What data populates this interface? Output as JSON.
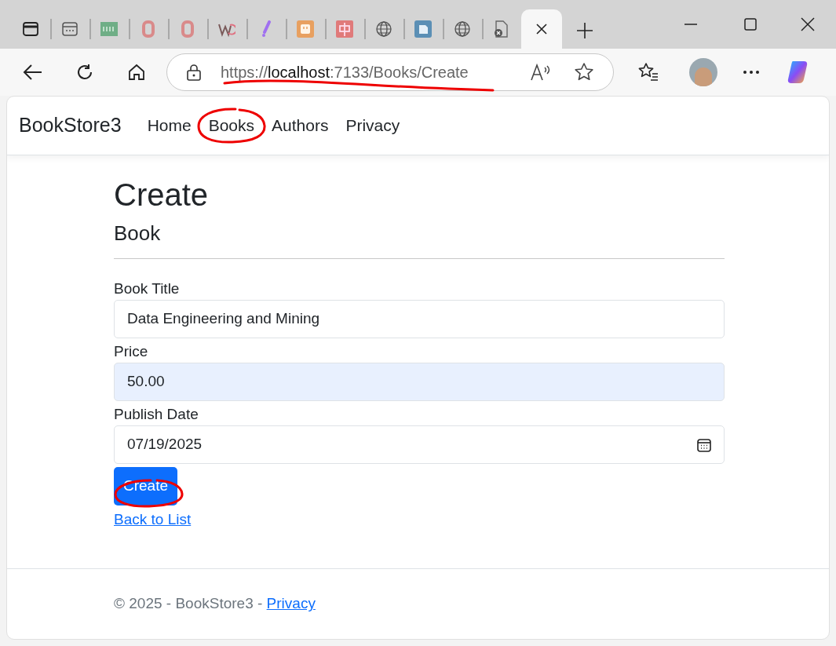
{
  "tabs": [
    {
      "kind": "sidebar",
      "selected": false
    },
    {
      "kind": "page",
      "selected": false
    },
    {
      "kind": "und",
      "selected": false
    },
    {
      "kind": "ring",
      "selected": false
    },
    {
      "kind": "ring",
      "selected": false
    },
    {
      "kind": "w",
      "selected": false
    },
    {
      "kind": "slash",
      "selected": false
    },
    {
      "kind": "plug",
      "selected": false
    },
    {
      "kind": "zhong",
      "selected": false
    },
    {
      "kind": "globe",
      "selected": false
    },
    {
      "kind": "square",
      "selected": false
    },
    {
      "kind": "globe",
      "selected": false
    },
    {
      "kind": "doc",
      "selected": false
    },
    {
      "kind": "blank",
      "selected": true
    }
  ],
  "address_bar": {
    "url": "https://**localhost**:7133/Books/Create"
  },
  "navbar": {
    "brand": "BookStore3",
    "links": [
      {
        "label": "Home",
        "selected": false
      },
      {
        "label": "Books",
        "selected": false
      },
      {
        "label": "Authors",
        "selected": false
      },
      {
        "label": "Privacy",
        "selected": false
      }
    ]
  },
  "heading": "Create",
  "subheading": "Book",
  "fields": [
    {
      "label": "Book Title",
      "value": "Data Engineering and Mining",
      "kind": "text",
      "autofilled": false
    },
    {
      "label": "Price",
      "value": "50.00",
      "kind": "text",
      "autofilled": true
    },
    {
      "label": "Publish Date",
      "value": "07/19/2025",
      "kind": "date",
      "autofilled": false
    }
  ],
  "submit_button": "Create",
  "back_link": "Back to List",
  "footer": {
    "text": "© 2025 - BookStore3 - ",
    "link": "Privacy"
  },
  "annotations": [
    {
      "kind": "url-underline"
    },
    {
      "kind": "books-circle"
    },
    {
      "kind": "create-circle"
    }
  ]
}
